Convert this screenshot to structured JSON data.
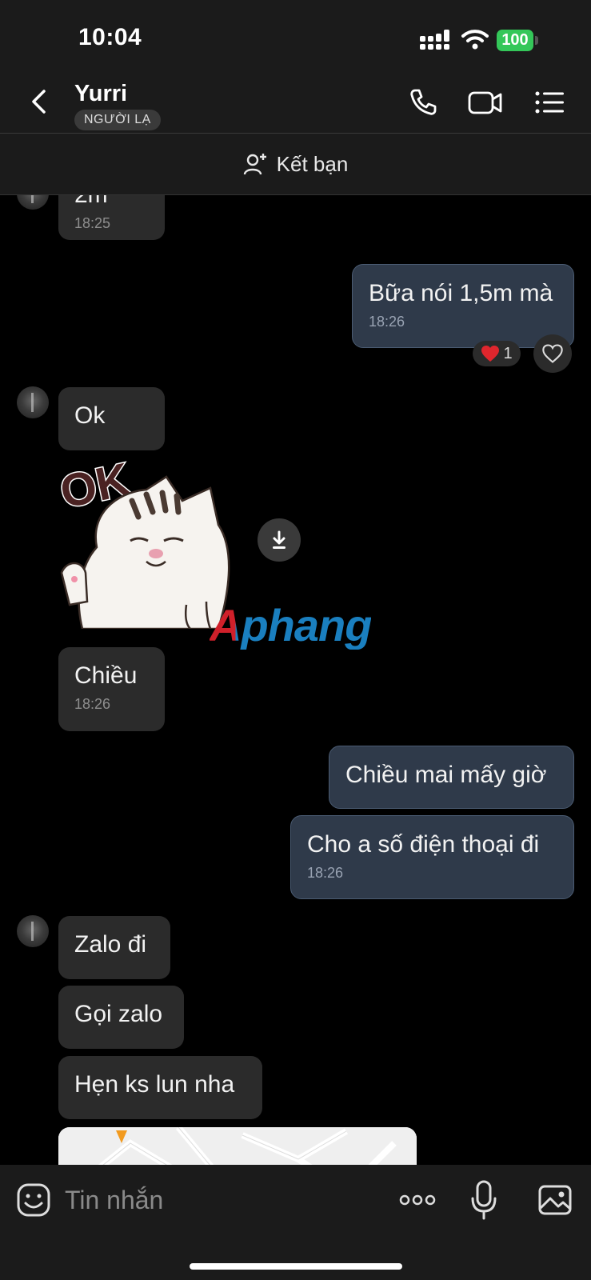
{
  "status_bar": {
    "time": "10:04",
    "battery": "100"
  },
  "header": {
    "contact_name": "Yurri",
    "badge": "NGƯỜI LẠ"
  },
  "add_friend": {
    "label": "Kết bạn"
  },
  "messages": [
    {
      "side": "in",
      "text": "2m",
      "time": "18:25"
    },
    {
      "side": "out",
      "text": "Bữa nói 1,5m mà",
      "time": "18:26",
      "reaction_count": "1"
    },
    {
      "side": "in",
      "text": "Ok",
      "time": ""
    },
    {
      "side": "in",
      "type": "sticker",
      "sticker_text": "OK"
    },
    {
      "side": "in",
      "text": "Chiều",
      "time": "18:26"
    },
    {
      "side": "out",
      "text": "Chiều mai mấy giờ",
      "time": ""
    },
    {
      "side": "out",
      "text": "Cho a số điện thoại đi",
      "time": "18:26"
    },
    {
      "side": "in",
      "text": "Zalo đi",
      "time": ""
    },
    {
      "side": "in",
      "text": "Gọi zalo",
      "time": ""
    },
    {
      "side": "in",
      "text": "Hẹn ks lun nha",
      "time": ""
    },
    {
      "side": "in",
      "type": "map"
    }
  ],
  "watermark": "Aphang",
  "input": {
    "placeholder": "Tin nhắn"
  },
  "colors": {
    "battery": "#34c759",
    "outgoing_bubble": "#2f3a4a",
    "incoming_bubble": "#2b2b2b",
    "reaction_heart": "#e0262d"
  }
}
